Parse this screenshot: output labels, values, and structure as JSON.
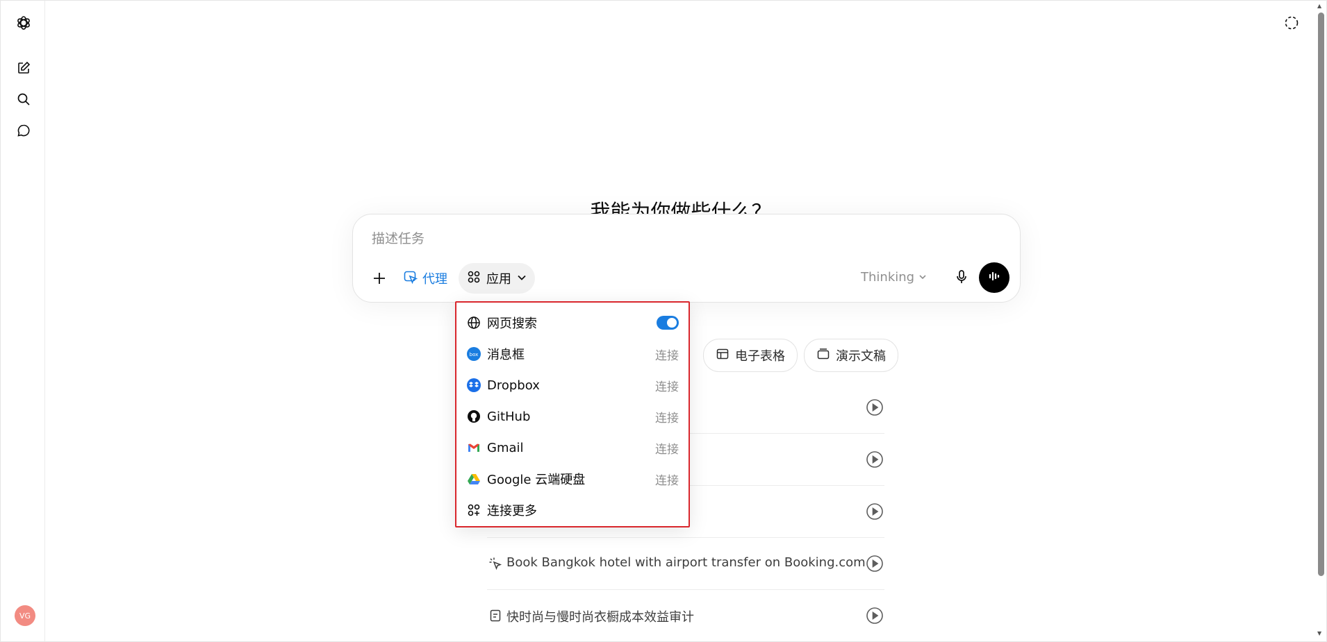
{
  "headline": "我能为你做些什么？",
  "composer": {
    "placeholder": "描述任务",
    "agent_label": "代理",
    "apps_label": "应用",
    "model_label": "Thinking"
  },
  "chips": [
    {
      "label": "电子表格",
      "icon": "table-icon"
    },
    {
      "label": "演示文稿",
      "icon": "slides-icon"
    }
  ],
  "tasks": [
    {
      "text": "",
      "icon": ""
    },
    {
      "text": "",
      "icon": ""
    },
    {
      "text": "",
      "icon": ""
    },
    {
      "text": "Book Bangkok hotel with airport transfer on Booking.com",
      "icon": "agent-cursor-icon"
    },
    {
      "text": "快时尚与慢时尚衣橱成本效益审计",
      "icon": "document-icon"
    }
  ],
  "dropdown": {
    "items": [
      {
        "label": "网页搜索",
        "icon": "globe-icon",
        "action": "toggle",
        "toggle_on": true
      },
      {
        "label": "消息框",
        "icon": "box-icon",
        "action": "连接"
      },
      {
        "label": "Dropbox",
        "icon": "dropbox-icon",
        "action": "连接"
      },
      {
        "label": "GitHub",
        "icon": "github-icon",
        "action": "连接"
      },
      {
        "label": "Gmail",
        "icon": "gmail-icon",
        "action": "连接"
      },
      {
        "label": "Google 云端硬盘",
        "icon": "google-drive-icon",
        "action": "连接"
      },
      {
        "label": "连接更多",
        "icon": "apps-add-icon",
        "action": ""
      }
    ]
  },
  "user": {
    "initials": "VG"
  },
  "colors": {
    "accent": "#1a7de0",
    "highlight_border": "#d9262c",
    "avatar": "#f28b82"
  }
}
